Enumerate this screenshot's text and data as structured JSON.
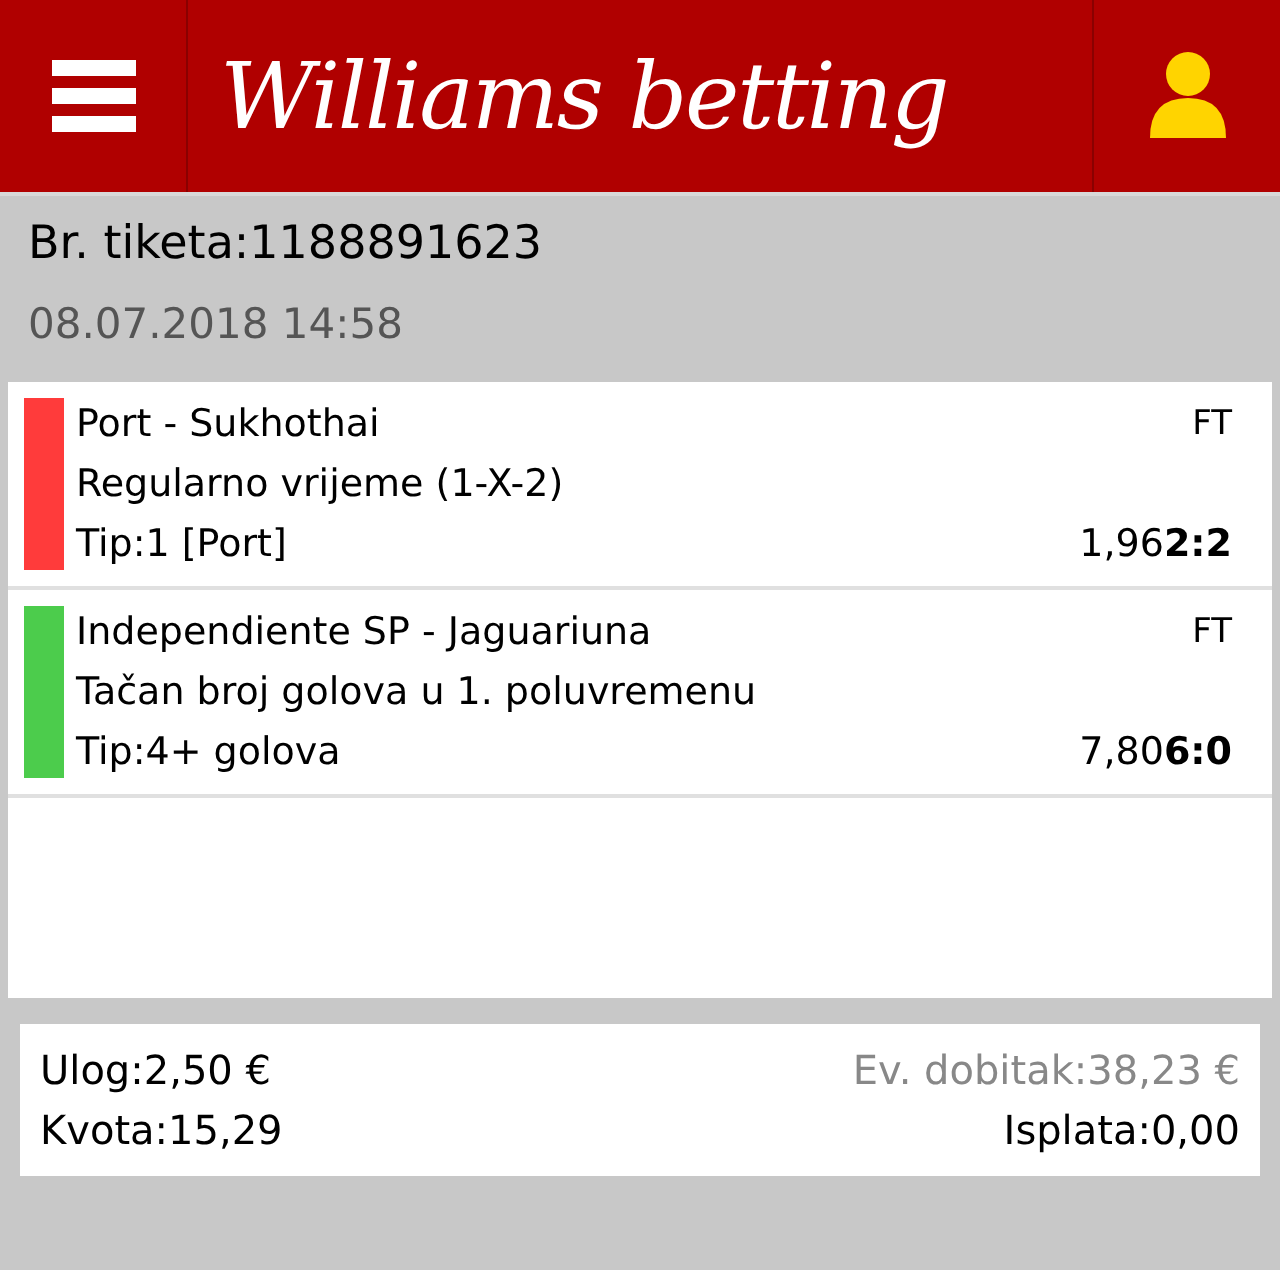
{
  "header": {
    "logo": "Williams betting"
  },
  "ticket": {
    "number": "Br. tiketa:1188891623",
    "datetime": "08.07.2018 14:58"
  },
  "bets": [
    {
      "match": "Port - Sukhothai",
      "status": "FT",
      "market": "Regularno vrijeme (1-X-2)",
      "tip": "Tip:1 [Port]",
      "odds": "1,96",
      "score": "2:2",
      "color": "#ff3b3b"
    },
    {
      "match": "Independiente SP - Jaguariuna",
      "status": "FT",
      "market": "Tačan broj golova u 1. poluvremenu",
      "tip": "Tip:4+ golova",
      "odds": "7,80",
      "score": "6:0",
      "color": "#4ccc4c"
    }
  ],
  "summary": {
    "stake": "Ulog:2,50 €",
    "possible_win": "Ev. dobitak:38,23 €",
    "odds": "Kvota:15,29",
    "payout": "Isplata:0,00"
  }
}
